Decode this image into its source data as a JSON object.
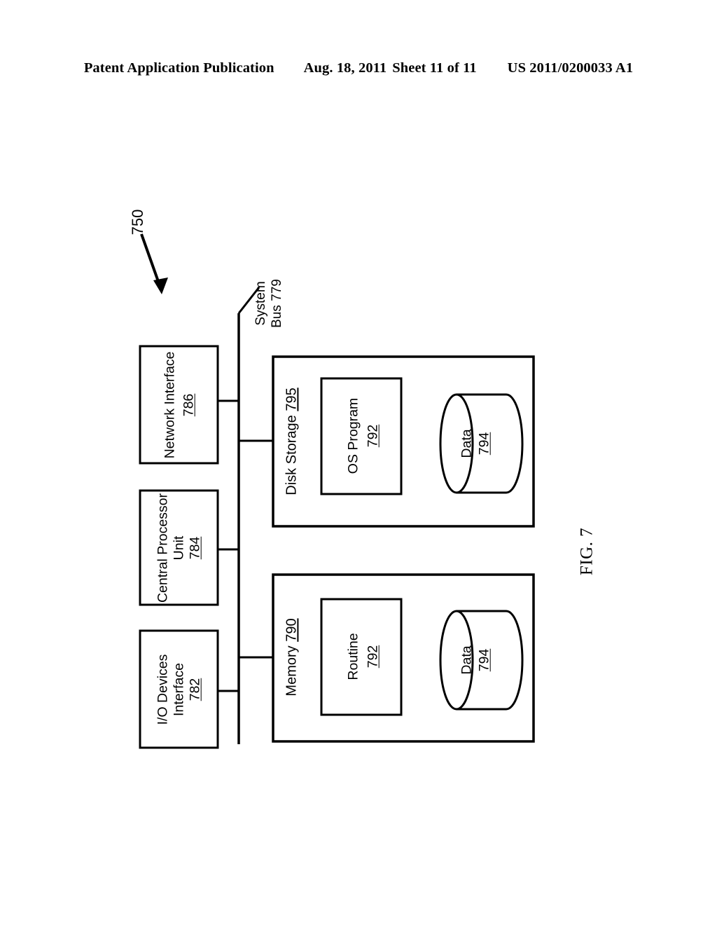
{
  "header": {
    "publication": "Patent Application Publication",
    "date": "Aug. 18, 2011",
    "sheet": "Sheet 11 of 11",
    "number": "US 2011/0200033 A1"
  },
  "figure": {
    "label": "FIG. 7",
    "system_reference": "750",
    "bus": {
      "name": "System",
      "reference": "Bus 779"
    },
    "components": [
      {
        "name": "network-interface",
        "line1": "Network Interface",
        "reference": "786"
      },
      {
        "name": "central-processor-unit",
        "line1": "Central Processor",
        "line2": "Unit",
        "reference": "784"
      },
      {
        "name": "io-devices-interface",
        "line1": "I/O Devices",
        "line2": "Interface",
        "reference": "782"
      }
    ],
    "containers": [
      {
        "name": "disk-storage",
        "label": "Disk Storage",
        "reference": "795",
        "program": {
          "label": "OS Program",
          "reference": "792"
        },
        "data": {
          "label": "Data",
          "reference": "794"
        }
      },
      {
        "name": "memory",
        "label": "Memory",
        "reference": "790",
        "program": {
          "label": "Routine",
          "reference": "792"
        },
        "data": {
          "label": "Data",
          "reference": "794"
        }
      }
    ]
  },
  "colors": {
    "ink": "#000000",
    "paper": "#ffffff"
  }
}
